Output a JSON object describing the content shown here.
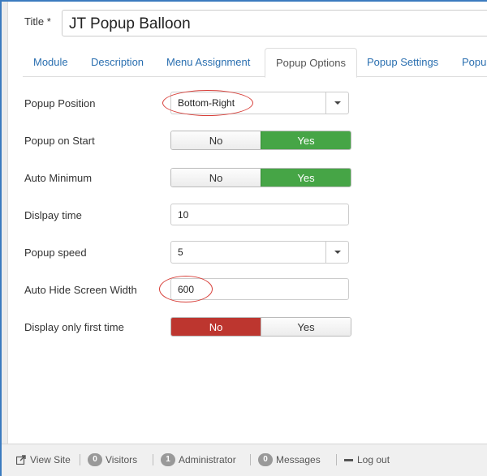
{
  "form": {
    "title_label": "Title *",
    "title_value": "JT Popup Balloon"
  },
  "tabs": [
    {
      "label": "Module",
      "active": false
    },
    {
      "label": "Description",
      "active": false
    },
    {
      "label": "Menu Assignment",
      "active": false
    },
    {
      "label": "Popup Options",
      "active": true
    },
    {
      "label": "Popup Settings",
      "active": false
    },
    {
      "label": "Popu",
      "active": false
    }
  ],
  "fields": {
    "popup_position": {
      "label": "Popup Position",
      "value": "Bottom-Right"
    },
    "popup_on_start": {
      "label": "Popup on Start",
      "no": "No",
      "yes": "Yes",
      "selected": "Yes"
    },
    "auto_minimum": {
      "label": "Auto Minimum",
      "no": "No",
      "yes": "Yes",
      "selected": "Yes"
    },
    "display_time": {
      "label": "Dislpay time",
      "value": "10"
    },
    "popup_speed": {
      "label": "Popup speed",
      "value": "5"
    },
    "auto_hide_width": {
      "label": "Auto Hide Screen Width",
      "value": "600"
    },
    "display_first_time": {
      "label": "Display only first time",
      "no": "No",
      "yes": "Yes",
      "selected": "No"
    }
  },
  "status_bar": {
    "view_site": "View Site",
    "visitors_count": "0",
    "visitors_label": "Visitors",
    "admin_count": "1",
    "admin_label": "Administrator",
    "messages_count": "0",
    "messages_label": "Messages",
    "logout": "Log out"
  },
  "colors": {
    "active_green": "#46a546",
    "active_red": "#bd362f",
    "link_blue": "#2a6fb0",
    "highlight_ellipse": "#d8403a"
  }
}
